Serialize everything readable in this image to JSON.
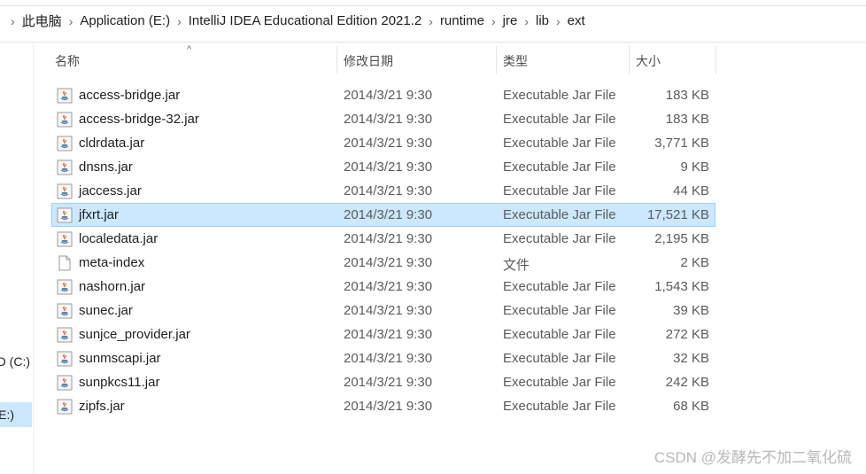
{
  "breadcrumb": [
    "此电脑",
    "Application (E:)",
    "IntelliJ IDEA Educational Edition 2021.2",
    "runtime",
    "jre",
    "lib",
    "ext"
  ],
  "nav": {
    "drive_c": "D (C:)",
    "drive_e": "E:)"
  },
  "columns": {
    "name": "名称",
    "date": "修改日期",
    "type": "类型",
    "size": "大小"
  },
  "files": [
    {
      "name": "access-bridge.jar",
      "date": "2014/3/21 9:30",
      "type": "Executable Jar File",
      "size": "183 KB",
      "icon": "jar-file-icon"
    },
    {
      "name": "access-bridge-32.jar",
      "date": "2014/3/21 9:30",
      "type": "Executable Jar File",
      "size": "183 KB",
      "icon": "jar-file-icon"
    },
    {
      "name": "cldrdata.jar",
      "date": "2014/3/21 9:30",
      "type": "Executable Jar File",
      "size": "3,771 KB",
      "icon": "jar-file-icon"
    },
    {
      "name": "dnsns.jar",
      "date": "2014/3/21 9:30",
      "type": "Executable Jar File",
      "size": "9 KB",
      "icon": "jar-file-icon"
    },
    {
      "name": "jaccess.jar",
      "date": "2014/3/21 9:30",
      "type": "Executable Jar File",
      "size": "44 KB",
      "icon": "jar-file-icon"
    },
    {
      "name": "jfxrt.jar",
      "date": "2014/3/21 9:30",
      "type": "Executable Jar File",
      "size": "17,521 KB",
      "icon": "jar-file-icon",
      "selected": true
    },
    {
      "name": "localedata.jar",
      "date": "2014/3/21 9:30",
      "type": "Executable Jar File",
      "size": "2,195 KB",
      "icon": "jar-file-icon"
    },
    {
      "name": "meta-index",
      "date": "2014/3/21 9:30",
      "type": "文件",
      "size": "2 KB",
      "icon": "blank-file-icon"
    },
    {
      "name": "nashorn.jar",
      "date": "2014/3/21 9:30",
      "type": "Executable Jar File",
      "size": "1,543 KB",
      "icon": "jar-file-icon"
    },
    {
      "name": "sunec.jar",
      "date": "2014/3/21 9:30",
      "type": "Executable Jar File",
      "size": "39 KB",
      "icon": "jar-file-icon"
    },
    {
      "name": "sunjce_provider.jar",
      "date": "2014/3/21 9:30",
      "type": "Executable Jar File",
      "size": "272 KB",
      "icon": "jar-file-icon"
    },
    {
      "name": "sunmscapi.jar",
      "date": "2014/3/21 9:30",
      "type": "Executable Jar File",
      "size": "32 KB",
      "icon": "jar-file-icon"
    },
    {
      "name": "sunpkcs11.jar",
      "date": "2014/3/21 9:30",
      "type": "Executable Jar File",
      "size": "242 KB",
      "icon": "jar-file-icon"
    },
    {
      "name": "zipfs.jar",
      "date": "2014/3/21 9:30",
      "type": "Executable Jar File",
      "size": "68 KB",
      "icon": "jar-file-icon"
    }
  ],
  "watermark": "CSDN @发酵先不加二氧化硫",
  "colors": {
    "selection_bg": "#cce8ff",
    "selection_border": "#99d1ff"
  }
}
